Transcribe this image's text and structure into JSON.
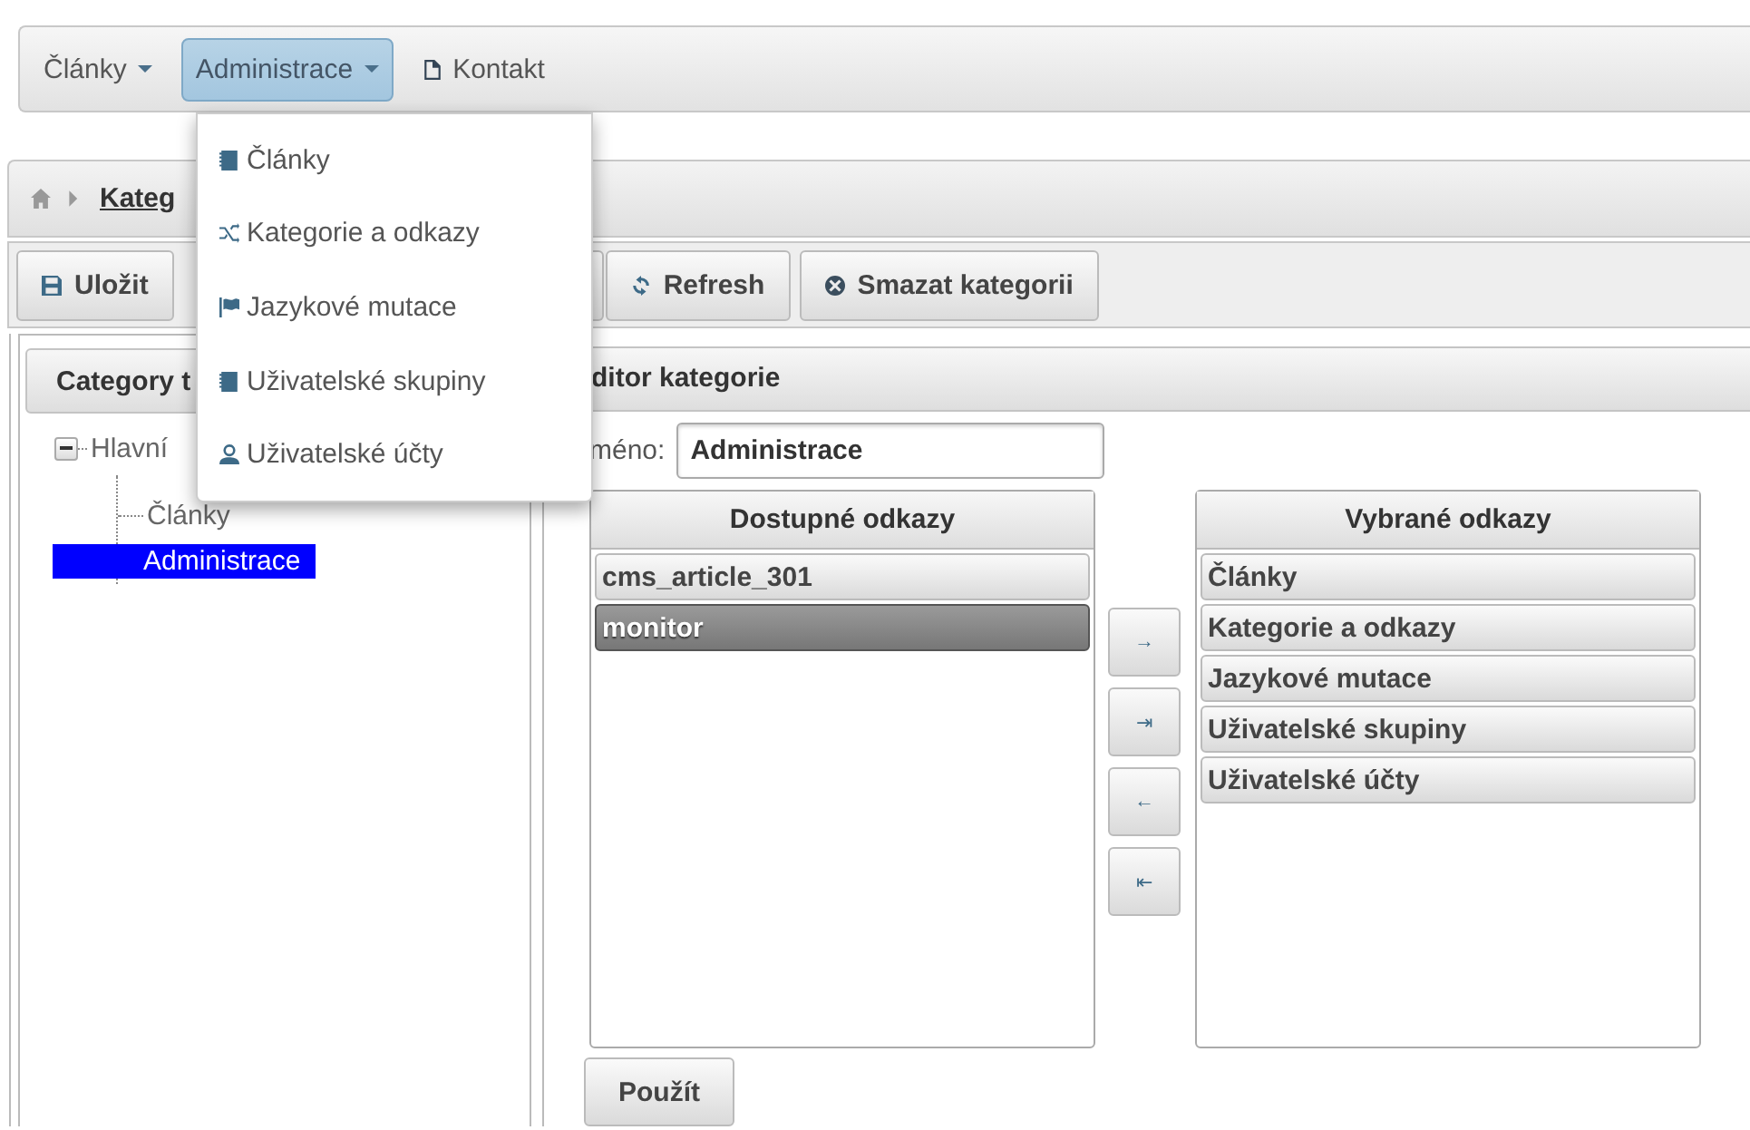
{
  "navbar": {
    "items": [
      {
        "label": "Články",
        "kind": "dropdown",
        "open": false
      },
      {
        "label": "Administrace",
        "kind": "dropdown",
        "open": true
      },
      {
        "label": "Kontakt",
        "kind": "link",
        "open": false
      }
    ]
  },
  "dropdown_menu": {
    "items": [
      {
        "label": "Články"
      },
      {
        "label": "Kategorie a odkazy"
      },
      {
        "label": "Jazykové mutace"
      },
      {
        "label": "Uživatelské skupiny"
      },
      {
        "label": "Uživatelské účty"
      }
    ]
  },
  "breadcrumb": {
    "items": [
      "Kateg"
    ]
  },
  "toolbar": {
    "buttons": [
      {
        "label": "Uložit"
      },
      {
        "label": "Refresh"
      },
      {
        "label": "Smazat kategorii"
      }
    ]
  },
  "tree_panel": {
    "title": "Category t",
    "tree": [
      {
        "label": "Hlavní",
        "expanded": true,
        "selected": false,
        "children": [
          {
            "label": "Články",
            "selected": false
          },
          {
            "label": "Administrace",
            "selected": true
          }
        ]
      }
    ]
  },
  "editor": {
    "title": "ditor kategorie",
    "name_label": "méno:",
    "name_value": "Administrace",
    "available": {
      "title": "Dostupné odkazy",
      "items": [
        {
          "label": "cms_article_301",
          "selected": false
        },
        {
          "label": "monitor",
          "selected": true
        }
      ]
    },
    "move_buttons": [
      "→",
      "⇥",
      "←",
      "⇤"
    ],
    "chosen": {
      "title": "Vybrané odkazy",
      "items": [
        {
          "label": "Články",
          "selected": false
        },
        {
          "label": "Kategorie a odkazy",
          "selected": false
        },
        {
          "label": "Jazykové mutace",
          "selected": false
        },
        {
          "label": "Uživatelské skupiny",
          "selected": false
        },
        {
          "label": "Uživatelské účty",
          "selected": false
        }
      ]
    },
    "apply_button": "Použít"
  }
}
